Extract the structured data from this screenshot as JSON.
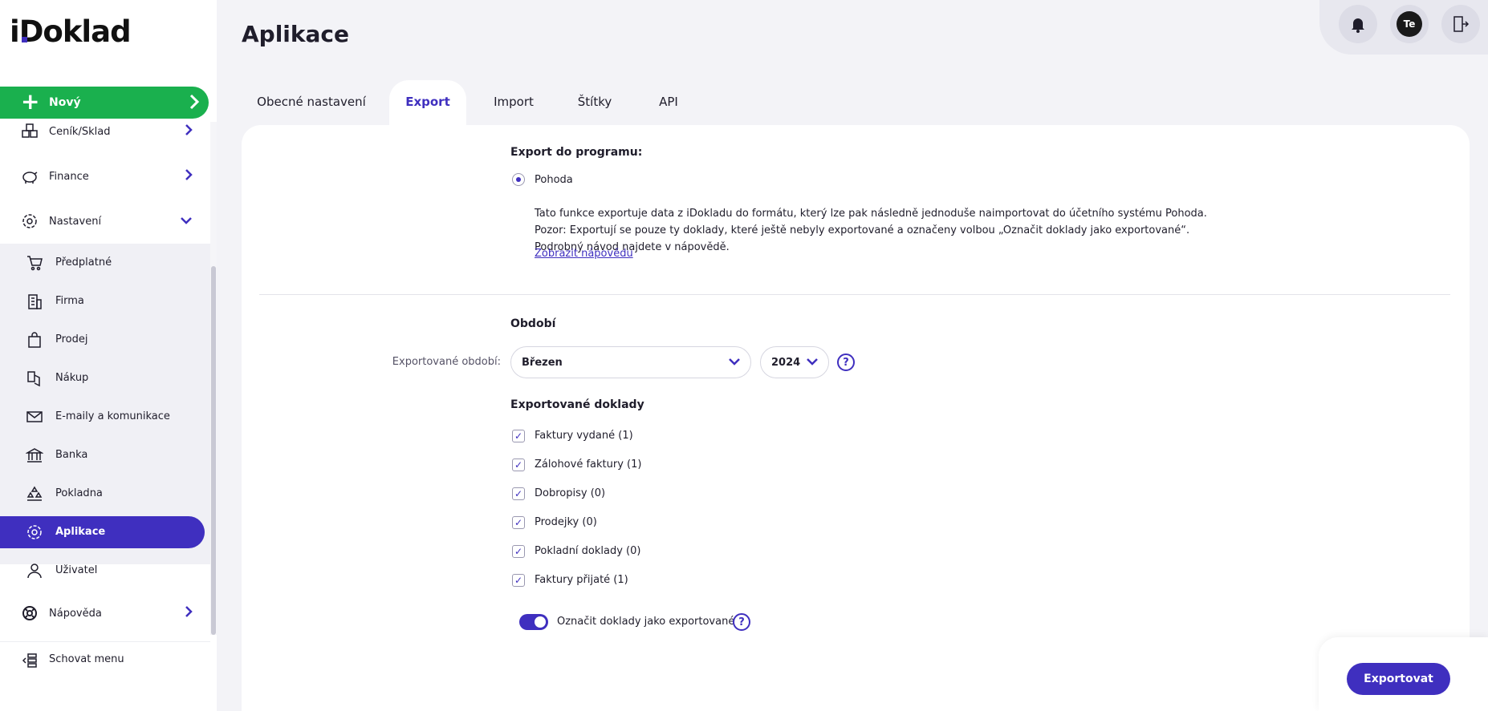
{
  "app": {
    "logo": "iDoklad"
  },
  "sidebar": {
    "new_label": "Nový",
    "items": [
      {
        "label": "Ceník/Sklad",
        "icon": "warehouse-icon"
      },
      {
        "label": "Finance",
        "icon": "piggy-bank-icon"
      },
      {
        "label": "Nastavení",
        "icon": "gear-icon"
      },
      {
        "label": "Nápověda",
        "icon": "lifebuoy-icon"
      }
    ],
    "sub_items": [
      {
        "label": "Předplatné",
        "icon": "cart-icon"
      },
      {
        "label": "Firma",
        "icon": "building-icon"
      },
      {
        "label": "Prodej",
        "icon": "shopping-bag-icon"
      },
      {
        "label": "Nákup",
        "icon": "purchase-icon"
      },
      {
        "label": "E-maily a komunikace",
        "icon": "mail-icon"
      },
      {
        "label": "Banka",
        "icon": "bank-icon"
      },
      {
        "label": "Pokladna",
        "icon": "cash-register-icon"
      },
      {
        "label": "Aplikace",
        "icon": "gear-icon",
        "active": true
      },
      {
        "label": "Uživatel",
        "icon": "user-icon"
      }
    ],
    "hide_menu": "Schovat menu"
  },
  "topbar": {
    "avatar_initials": "Te"
  },
  "page": {
    "title": "Aplikace"
  },
  "tabs": [
    {
      "label": "Obecné nastavení"
    },
    {
      "label": "Export",
      "active": true
    },
    {
      "label": "Import"
    },
    {
      "label": "Štítky"
    },
    {
      "label": "API"
    }
  ],
  "export": {
    "program_title": "Export do programu:",
    "program_option": "Pohoda",
    "description": "Tato funkce exportuje data z iDokladu do formátu, který lze pak následně jednoduše naimportovat do účetního systému Pohoda. Pozor: Exportují se pouze ty doklady, které ještě nebyly exportované a označeny volbou „Označit doklady jako exportované“. Podrobný návod najdete v nápovědě.",
    "help_link": "Zobrazit nápovědu",
    "period_title": "Období",
    "period_label": "Exportované období:",
    "month": "Březen",
    "year": "2024",
    "documents_title": "Exportované doklady",
    "documents": [
      {
        "label": "Faktury vydané (1)",
        "checked": true
      },
      {
        "label": "Zálohové faktury (1)",
        "checked": true
      },
      {
        "label": "Dobropisy (0)",
        "checked": true
      },
      {
        "label": "Prodejky (0)",
        "checked": true
      },
      {
        "label": "Pokladní doklady (0)",
        "checked": true
      },
      {
        "label": "Faktury přijaté (1)",
        "checked": true
      }
    ],
    "mark_exported_label": "Označit doklady jako exportované",
    "mark_exported_on": true,
    "export_button": "Exportovat"
  },
  "colors": {
    "accent": "#3f2fbf",
    "new_button": "#1ab04e"
  }
}
